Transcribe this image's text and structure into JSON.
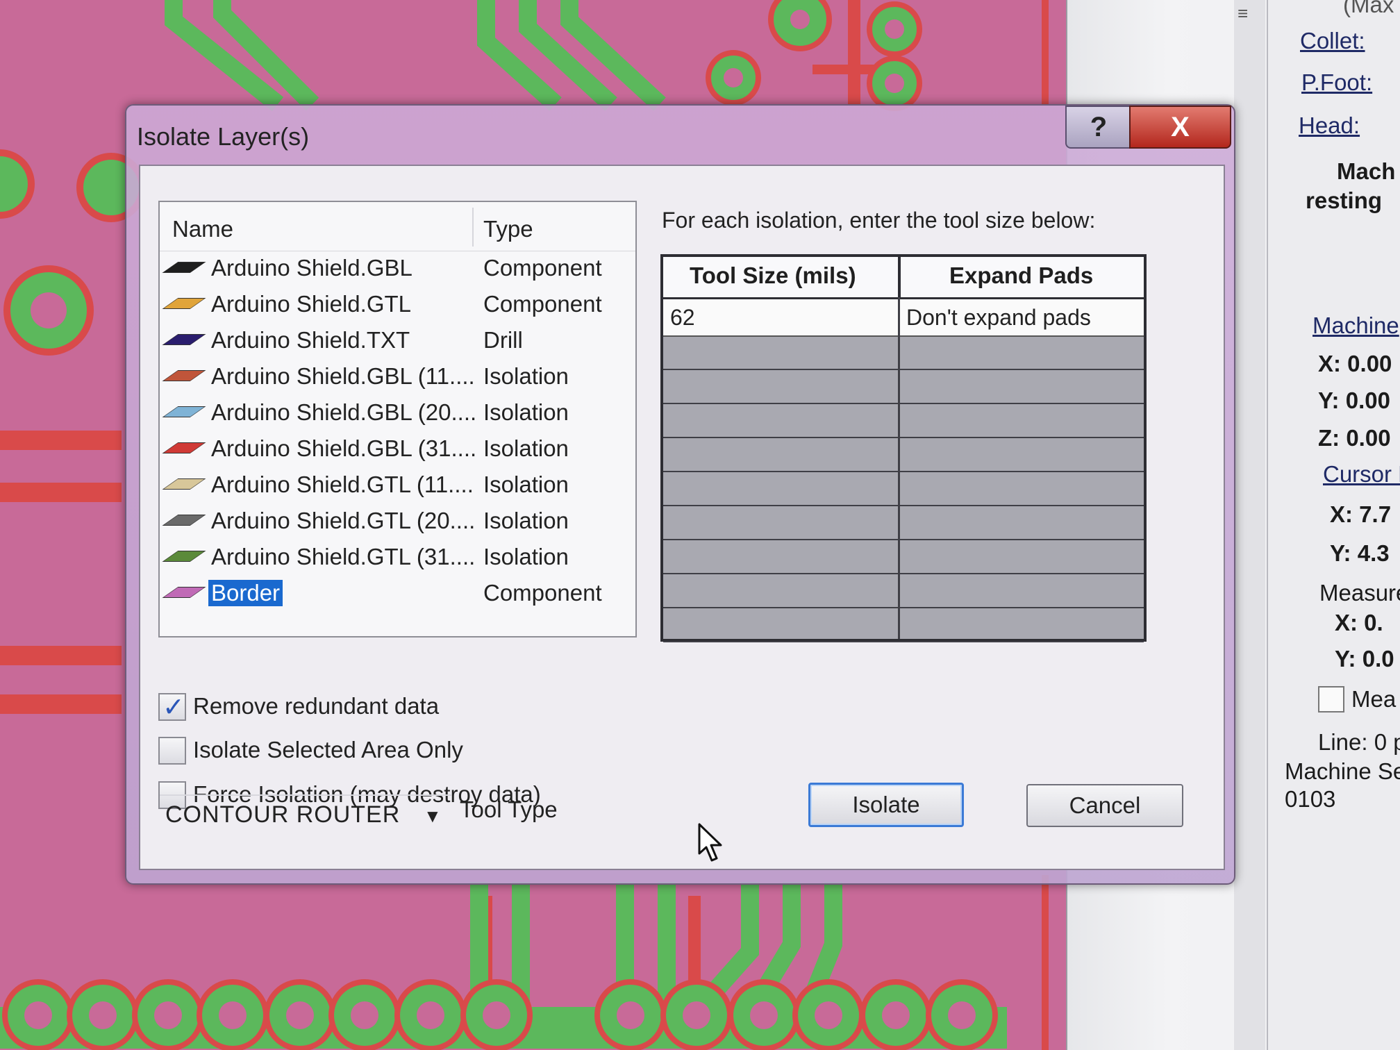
{
  "dialog": {
    "title": "Isolate Layer(s)",
    "help_label": "?",
    "close_label": "X"
  },
  "layer_list": {
    "columns": {
      "name": "Name",
      "type": "Type"
    },
    "items": [
      {
        "name": "Arduino Shield.GBL",
        "type": "Component",
        "color": "#1e1e1e",
        "selected": false
      },
      {
        "name": "Arduino Shield.GTL",
        "type": "Component",
        "color": "#e0a43a",
        "selected": false
      },
      {
        "name": "Arduino Shield.TXT",
        "type": "Drill",
        "color": "#2a1d6e",
        "selected": false
      },
      {
        "name": "Arduino Shield.GBL (11....",
        "type": "Isolation",
        "color": "#c0553a",
        "selected": false
      },
      {
        "name": "Arduino Shield.GBL (20....",
        "type": "Isolation",
        "color": "#7fb3d6",
        "selected": false
      },
      {
        "name": "Arduino Shield.GBL (31....",
        "type": "Isolation",
        "color": "#d03a36",
        "selected": false
      },
      {
        "name": "Arduino Shield.GTL (11....",
        "type": "Isolation",
        "color": "#d8c79a",
        "selected": false
      },
      {
        "name": "Arduino Shield.GTL (20....",
        "type": "Isolation",
        "color": "#6a6a6a",
        "selected": false
      },
      {
        "name": "Arduino Shield.GTL (31....",
        "type": "Isolation",
        "color": "#5b8a3a",
        "selected": false
      },
      {
        "name": "Border",
        "type": "Component",
        "color": "#c06ab6",
        "selected": true
      }
    ]
  },
  "tool_table": {
    "instruction": "For each isolation, enter the tool size below:",
    "headers": {
      "tool_size": "Tool Size (mils)",
      "expand_pads": "Expand Pads"
    },
    "rows": [
      {
        "tool_size": "62",
        "expand_pads": "Don't expand pads"
      }
    ]
  },
  "options": {
    "remove_redundant": {
      "label": "Remove redundant data",
      "checked": true
    },
    "isolate_selected": {
      "label": "Isolate Selected Area Only",
      "checked": false
    },
    "force_isolation": {
      "label": "Force Isolation (may destroy data)",
      "checked": false
    }
  },
  "tool_type": {
    "value": "CONTOUR ROUTER",
    "label": "Tool Type"
  },
  "buttons": {
    "isolate": "Isolate",
    "cancel": "Cancel"
  },
  "right_panel": {
    "max_label": "(Max",
    "collet": "Collet:",
    "pfoot": "P.Foot:",
    "head": "Head:",
    "mach_status_1": "Mach",
    "mach_status_2": "resting",
    "machine_header": "Machine",
    "mx": "X: 0.00",
    "my": "Y: 0.00",
    "mz": "Z: 0.00",
    "cursor_header": "Cursor P",
    "cx": "X: 7.7",
    "cy": "Y: 4.3",
    "measure_header": "Measure",
    "meas_x": "X: 0.",
    "meas_y": "Y: 0.0",
    "meas_check": "Mea",
    "line": "Line: 0 p",
    "machine_se": "Machine Se",
    "code": "0103"
  },
  "colors": {
    "pcb_background": "#c86a98",
    "trace_green": "#5cb85c",
    "trace_red": "#d94a4a",
    "selection": "#1a69cf"
  }
}
